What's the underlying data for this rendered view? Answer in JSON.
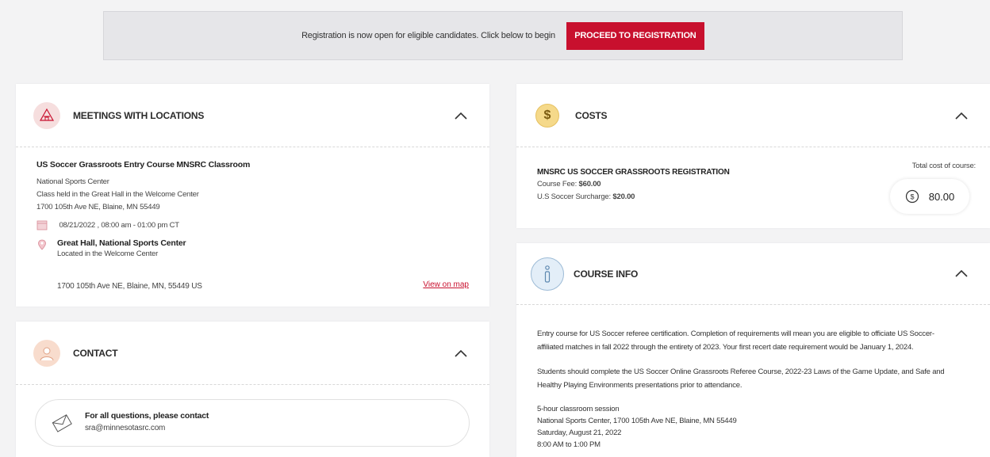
{
  "banner": {
    "text": "Registration is now open for eligible candidates. Click below to begin",
    "button_label": "PROCEED TO REGISTRATION"
  },
  "meetings": {
    "title": "MEETINGS WITH LOCATIONS",
    "icon": "building-icon",
    "course_name": "US Soccer Grassroots Entry Course MNSRC Classroom",
    "venue": "National Sports Center",
    "note": "Class held in the Great Hall in the Welcome Center",
    "address_line": "1700 105th Ave NE, Blaine, MN 55449",
    "datetime": "08/21/2022 , 08:00 am - 01:00 pm CT",
    "location_name": "Great Hall, National Sports Center",
    "location_note": "Located in the Welcome Center",
    "location_address": "1700 105th Ave NE, Blaine, MN, 55449 US",
    "map_link": "View on map"
  },
  "contact": {
    "title": "CONTACT",
    "icon": "person-icon",
    "label": "For all questions, please contact",
    "email": "sra@minnesotasrc.com"
  },
  "costs": {
    "title": "COSTS",
    "icon": "dollar-icon",
    "heading": "MNSRC US SOCCER GRASSROOTS REGISTRATION",
    "fee_label": "Course Fee:",
    "fee_value": "$60.00",
    "surcharge_label": "U.S Soccer Surcharge:",
    "surcharge_value": "$20.00",
    "total_label": "Total cost of course:",
    "total_value": "80.00"
  },
  "course_info": {
    "title": "COURSE INFO",
    "icon": "info-icon",
    "p1_line1": "Entry course for US Soccer referee certification. Completion of requirements will mean you are eligible to officiate US Soccer-",
    "p1_line2": "affiliated matches in fall 2022 through the entirety of 2023. Your first recert date requirement would be January 1, 2024.",
    "p2_line1": "Students should complete the US Soccer Online Grassroots Referee Course, 2022-23 Laws of the Game Update, and Safe and",
    "p2_line2": "Healthy Playing Environments presentations prior to attendance.",
    "p3_line1": "5-hour classroom session",
    "p3_line2": "National Sports Center, 1700 105th Ave NE, Blaine, MN 55449",
    "p3_line3": "Saturday, August 21, 2022",
    "p3_line4": "8:00 AM to 1:00 PM"
  },
  "colors": {
    "accent": "#c8102e",
    "background": "#f3f3f4"
  }
}
